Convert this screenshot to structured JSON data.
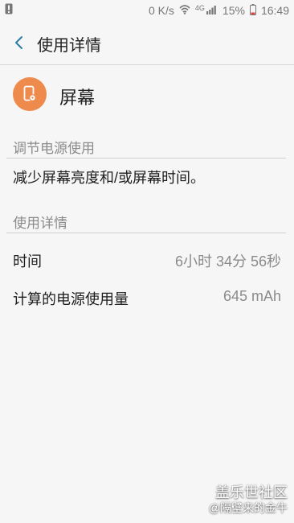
{
  "status_bar": {
    "net_speed": "0 K/s",
    "network_type": "4G",
    "battery_percent": "15%",
    "time": "16:49",
    "icons": [
      "warning-icon",
      "wifi-icon",
      "signal-icon",
      "battery-icon"
    ]
  },
  "header": {
    "title": "使用详情",
    "back_icon": "chevron-left-icon"
  },
  "app": {
    "name": "屏幕",
    "icon": "screen-settings-icon",
    "icon_color": "#ee8a4c"
  },
  "sections": {
    "adjust_title": "调节电源使用",
    "adjust_text": "减少屏幕亮度和/或屏幕时间。",
    "details_title": "使用详情"
  },
  "details": {
    "time_label": "时间",
    "time_value": "6小时 34分 56秒",
    "power_label": "计算的电源使用量",
    "power_value": "645 mAh"
  },
  "watermark": {
    "line1": "盖乐世社区",
    "line2": "@隔壁来的金牛"
  }
}
